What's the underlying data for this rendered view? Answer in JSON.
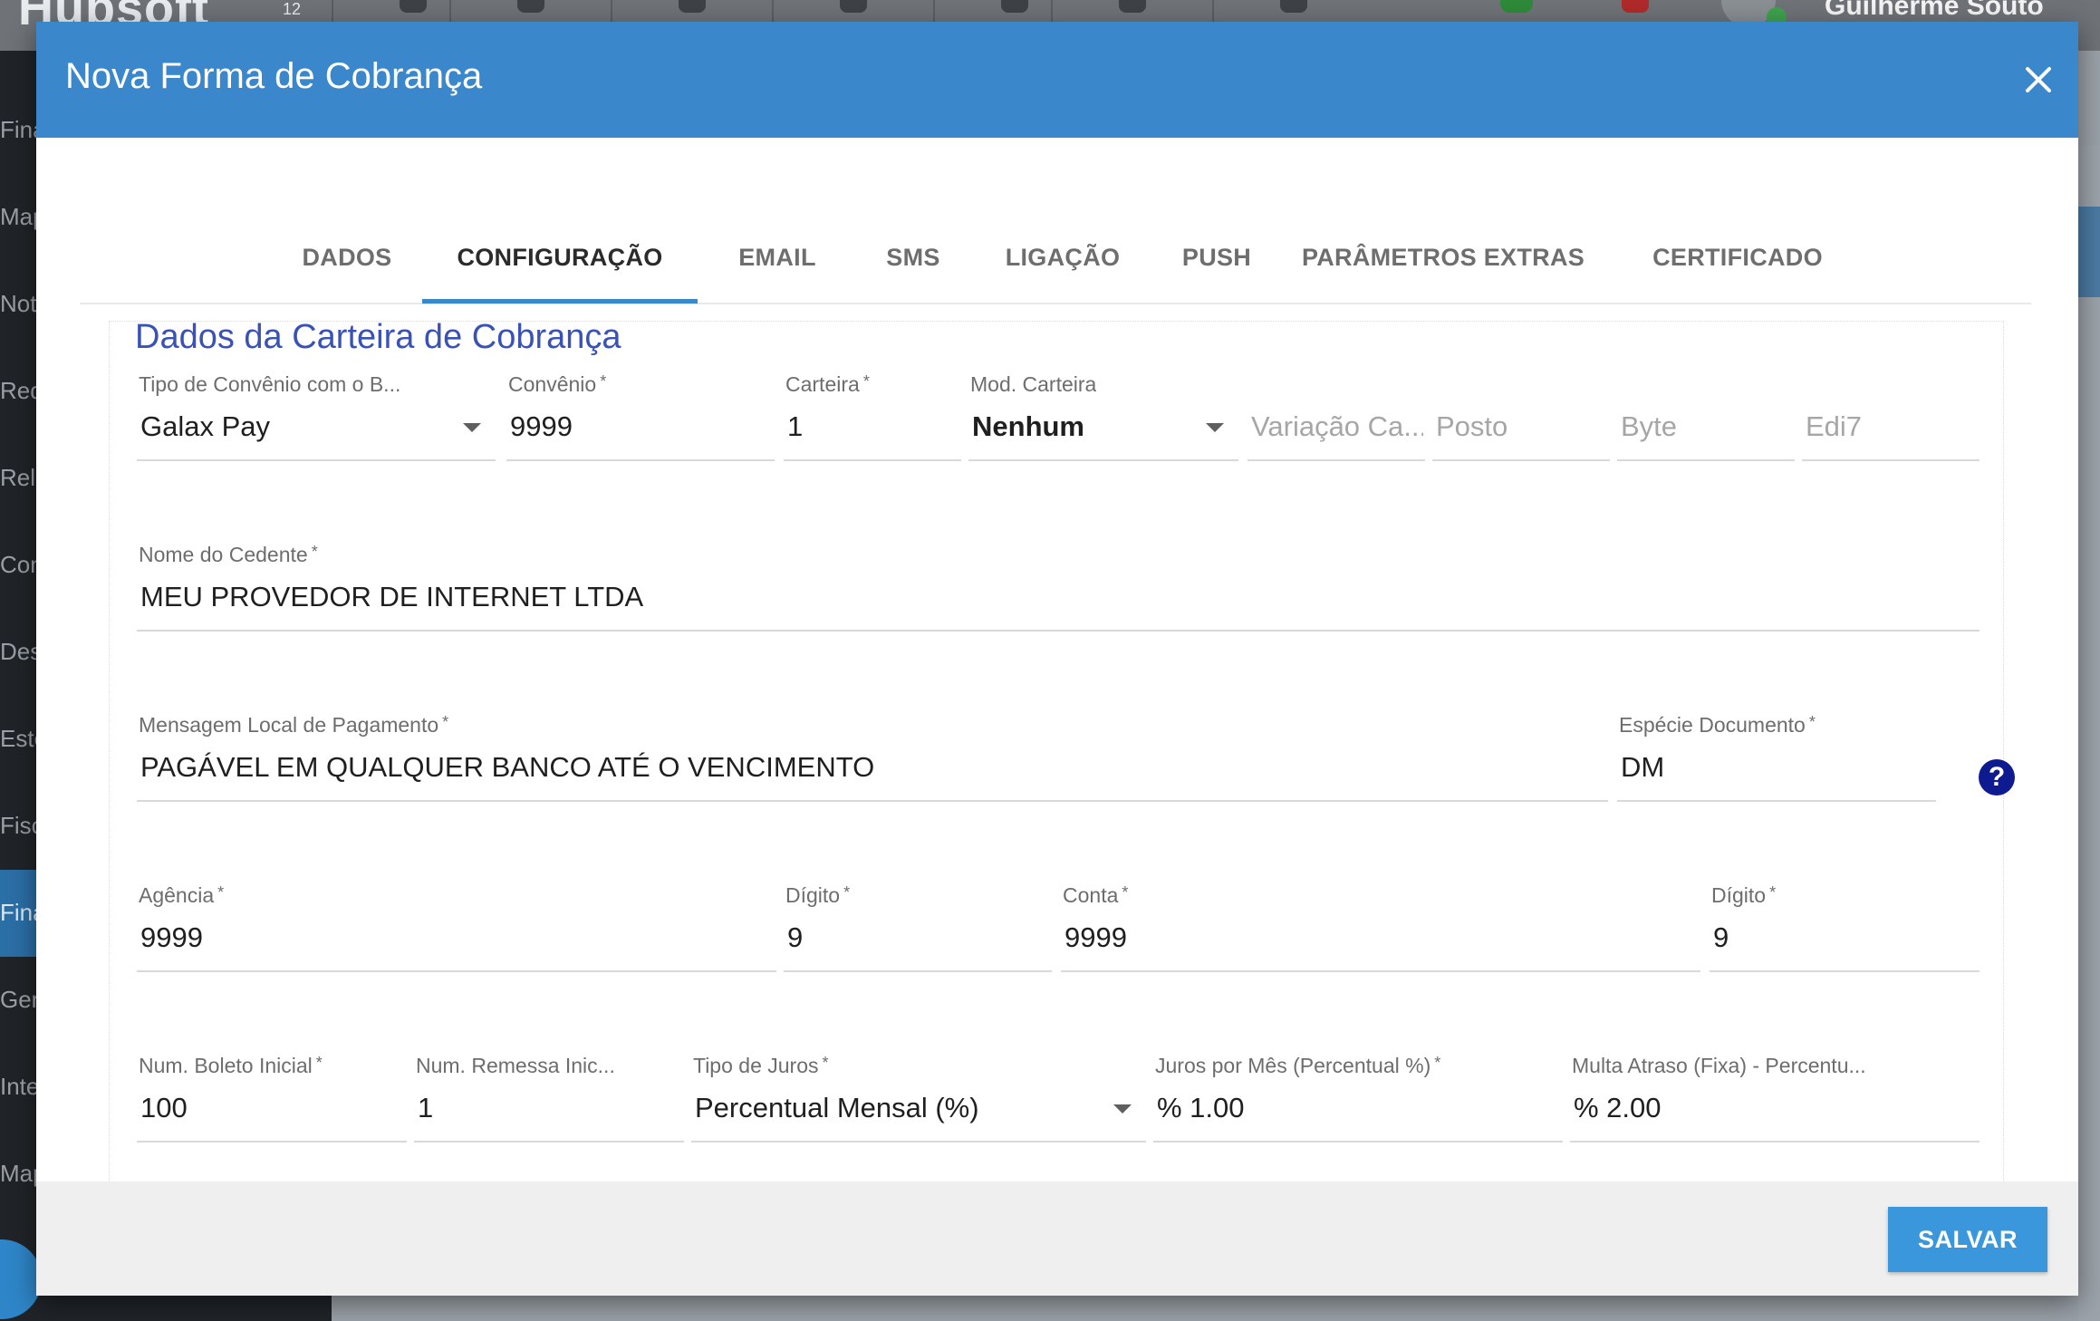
{
  "background": {
    "logo": "Hubsoft",
    "logo_sup": "12",
    "user_name": "Guilherme Souto",
    "sidebar": [
      "Fina",
      "Map",
      "Not",
      "Red",
      "Rela",
      "Con",
      "Des",
      "Esto",
      "Fisc",
      "Fina",
      "Ger",
      "Inte",
      "Map"
    ]
  },
  "dialog": {
    "title": "Nova Forma de Cobrança",
    "close_icon": "close-icon",
    "tabs": [
      {
        "label": "DADOS"
      },
      {
        "label": "CONFIGURAÇÃO",
        "active": true
      },
      {
        "label": "EMAIL"
      },
      {
        "label": "SMS"
      },
      {
        "label": "LIGAÇÃO"
      },
      {
        "label": "PUSH"
      },
      {
        "label": "PARÂMETROS EXTRAS"
      },
      {
        "label": "CERTIFICADO"
      }
    ],
    "section_title": "Dados da Carteira de Cobrança",
    "fields": {
      "tipo_convenio": {
        "label": "Tipo de Convênio com o B...",
        "value": "Galax Pay"
      },
      "convenio": {
        "label": "Convênio",
        "required": "*",
        "value": "9999"
      },
      "carteira": {
        "label": "Carteira",
        "required": "*",
        "value": "1"
      },
      "mod_carteira": {
        "label": "Mod. Carteira",
        "value": "Nenhum"
      },
      "variacao_carteira": {
        "placeholder": "Variação Ca..."
      },
      "posto": {
        "placeholder": "Posto"
      },
      "byte": {
        "placeholder": "Byte"
      },
      "edi7": {
        "placeholder": "Edi7"
      },
      "nome_cedente": {
        "label": "Nome do Cedente",
        "required": "*",
        "value": "MEU PROVEDOR DE INTERNET LTDA"
      },
      "mensagem_local": {
        "label": "Mensagem Local de Pagamento",
        "required": "*",
        "value": "PAGÁVEL EM QUALQUER BANCO ATÉ O VENCIMENTO"
      },
      "especie_documento": {
        "label": "Espécie Documento",
        "required": "*",
        "value": "DM"
      },
      "agencia": {
        "label": "Agência",
        "required": "*",
        "value": "9999"
      },
      "agencia_digito": {
        "label": "Dígito",
        "required": "*",
        "value": "9"
      },
      "conta": {
        "label": "Conta",
        "required": "*",
        "value": "9999"
      },
      "conta_digito": {
        "label": "Dígito",
        "required": "*",
        "value": "9"
      },
      "num_boleto_inicial": {
        "label": "Num. Boleto Inicial",
        "required": "*",
        "value": "100"
      },
      "num_remessa_inicial": {
        "label": "Num. Remessa Inic...",
        "value": "1"
      },
      "tipo_juros": {
        "label": "Tipo de Juros",
        "required": "*",
        "value": "Percentual Mensal (%)"
      },
      "juros_mes": {
        "label": "Juros por Mês (Percentual %)",
        "required": "*",
        "value": "% 1.00"
      },
      "multa_atraso": {
        "label": "Multa Atraso (Fixa) - Percentu...",
        "value": "% 2.00"
      }
    },
    "help_icon": "?",
    "save_label": "SALVAR"
  }
}
